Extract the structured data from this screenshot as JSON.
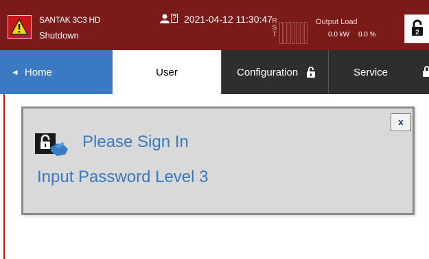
{
  "header": {
    "model": "SANTAK 3C3 HD",
    "state": "Shutdown",
    "help_mark": "?",
    "datetime": "2021-04-12 11:30:47",
    "phases": [
      "R",
      "S",
      "T"
    ],
    "output_load_label": "Output Load",
    "output_kw": "0.0 kW",
    "output_pct": "0.0 %",
    "warning_icon": "warning-triangle-icon",
    "user_icon": "user-icon",
    "lock_icon": "lock-icon"
  },
  "tabs": {
    "home": "Home",
    "user": "User",
    "configuration": "Configuration",
    "service": "Service"
  },
  "dialog": {
    "close_label": "x",
    "title": "Please Sign In",
    "subtitle": "Input Password Level 3",
    "icon": "sign-in-lock-icon"
  },
  "colors": {
    "header_bg": "#7a1b1a",
    "home_tab": "#3c79c3",
    "dark_tab": "#2e2e2e",
    "dialog_text": "#3a79be",
    "alert": "#c8161d"
  }
}
